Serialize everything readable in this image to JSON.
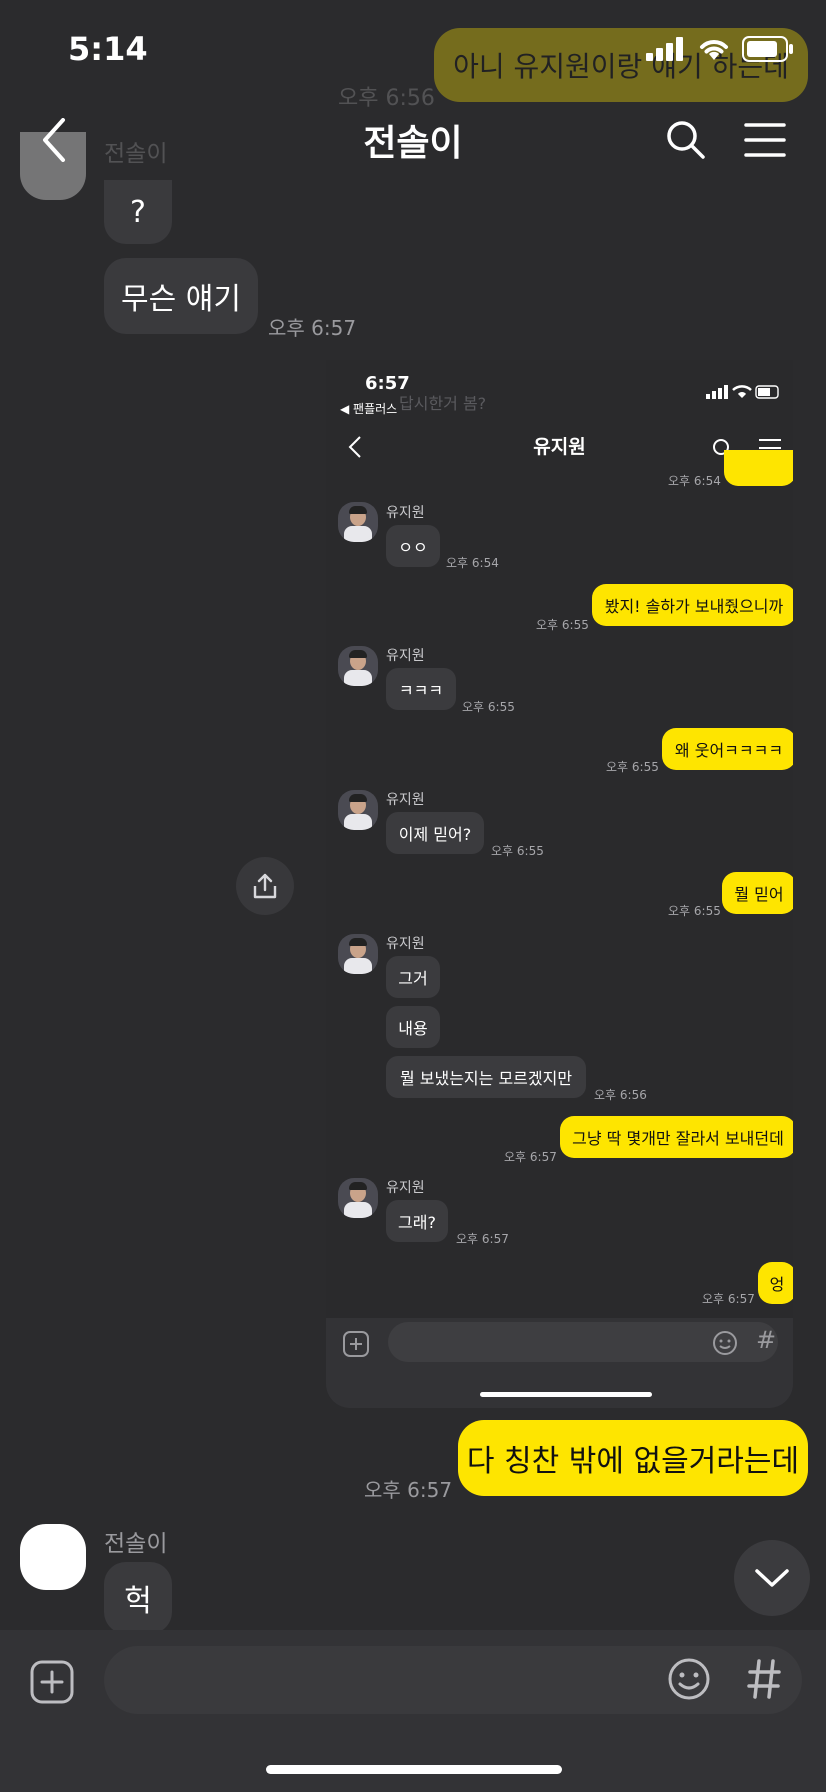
{
  "status_bar": {
    "time": "5:14"
  },
  "header": {
    "title": "전솔이"
  },
  "ghost": {
    "bubble": "아니 유지원이랑 얘기 하는데",
    "time": "오후 6:56",
    "sender": "전솔이"
  },
  "messages_top": {
    "q_bubble": "?",
    "bubble2": "무슨 얘기",
    "time": "오후 6:57"
  },
  "embedded": {
    "status_time": "6:57",
    "back_app": "◀ 팬플러스",
    "title": "유지원",
    "ghost_text": "답시한거 봄?",
    "first_time": "오후 6:54",
    "items": [
      {
        "type": "in",
        "sender": "유지원",
        "text": "ㅇㅇ",
        "time": "오후 6:54"
      },
      {
        "type": "out",
        "text": "봤지! 솔하가 보내줬으니까",
        "time": "오후 6:55"
      },
      {
        "type": "in",
        "sender": "유지원",
        "text": "ㅋㅋㅋ",
        "time": "오후 6:55"
      },
      {
        "type": "out",
        "text": "왜 웃어ㅋㅋㅋㅋ",
        "time": "오후 6:55"
      },
      {
        "type": "in",
        "sender": "유지원",
        "text": "이제 믿어?",
        "time": "오후 6:55"
      },
      {
        "type": "out",
        "text": "뭘 믿어",
        "time": "오후 6:55"
      },
      {
        "type": "in",
        "sender": "유지원",
        "text": "그거",
        "text2": "내용",
        "text3": "뭘 보냈는지는 모르겠지만",
        "time": "오후 6:56"
      },
      {
        "type": "out",
        "text": "그냥 딱 몇개만 잘라서 보내던데",
        "time": "오후 6:57"
      },
      {
        "type": "in",
        "sender": "유지원",
        "text": "그래?",
        "time": "오후 6:57"
      },
      {
        "type": "out",
        "text": "엉",
        "time": "오후 6:57"
      }
    ]
  },
  "messages_bottom": {
    "out_bubble": "다 칭찬 밖에 없을거라는데",
    "out_time": "오후 6:57",
    "sender": "전솔이",
    "in_bubble": "헉"
  },
  "input": {
    "placeholder": ""
  },
  "colors": {
    "background": "#2b2b2d",
    "bubble_gray": "#3a3a3d",
    "bubble_yellow": "#fee500"
  }
}
